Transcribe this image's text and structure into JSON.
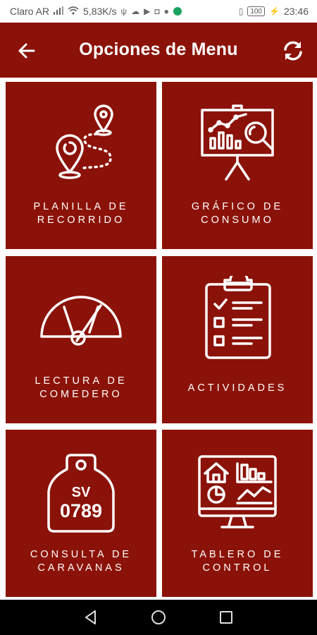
{
  "status_bar": {
    "carrier": "Claro AR",
    "speed": "5,83K/s",
    "battery": "100",
    "time": "23:46"
  },
  "app_bar": {
    "title": "Opciones de Menu",
    "back_icon": "arrow-left-icon",
    "refresh_icon": "refresh-icon"
  },
  "menu": {
    "items": [
      {
        "label": "PLANILLA DE\nRECORRIDO",
        "icon": "route-map-icon"
      },
      {
        "label": "GRÁFICO DE\nCONSUMO",
        "icon": "chart-board-icon"
      },
      {
        "label": "LECTURA DE\nCOMEDERO",
        "icon": "gauge-icon"
      },
      {
        "label": "ACTIVIDADES",
        "icon": "clipboard-checklist-icon"
      },
      {
        "label": "CONSULTA DE\nCARAVANAS",
        "icon": "ear-tag-icon",
        "tag_code": "SV",
        "tag_number": "0789"
      },
      {
        "label": "TABLERO DE\nCONTROL",
        "icon": "dashboard-monitor-icon"
      }
    ]
  },
  "colors": {
    "primary": "#8b1208",
    "on_primary": "#ffffff"
  }
}
